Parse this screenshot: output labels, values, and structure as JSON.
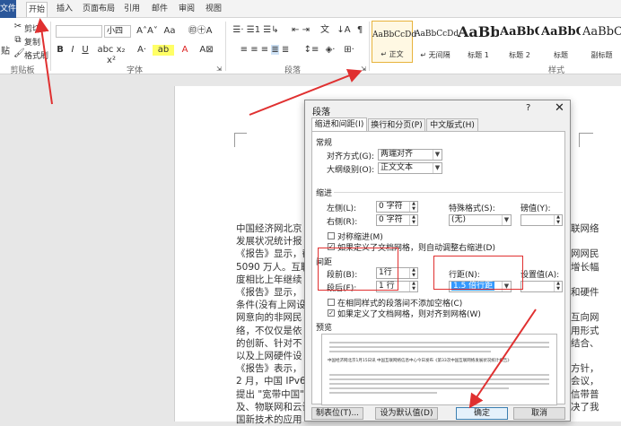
{
  "ribbon": {
    "tabs": [
      "文件",
      "开始",
      "插入",
      "页面布局",
      "引用",
      "邮件",
      "审阅",
      "视图"
    ],
    "clipboard": {
      "cut": "剪切",
      "copy": "复制",
      "paste_stub": "贴",
      "format_painter": "格式刷",
      "label": "剪贴板"
    },
    "font": {
      "size": "小四",
      "label": "字体"
    },
    "paragraph": {
      "label": "段落"
    },
    "styles": {
      "label": "样式",
      "items": [
        {
          "preview": "AaBbCcDd",
          "name": "↵ 正文"
        },
        {
          "preview": "AaBbCcDd",
          "name": "↵ 无间隔"
        },
        {
          "preview": "AaBb",
          "name": "标题 1"
        },
        {
          "preview": "AaBbC",
          "name": "标题 2"
        },
        {
          "preview": "AaBbC",
          "name": "标题"
        },
        {
          "preview": "AaBbC",
          "name": "副标题"
        }
      ]
    }
  },
  "document": {
    "left_lines": [
      "中国经济网北京",
      "发展状况统计报",
      "《报告》显示，截",
      "5090 万人。互联",
      "度相比上年继续",
      "《报告》显示，",
      "条件(没有上网设",
      "网意向的非网民",
      "络，不仅仅是依",
      "的创新、针对不",
      "以及上网硬件设",
      "《报告》表示，",
      "2 月，中国 IPv6 发",
      "提出 \"宽带中国\"",
      "及、物联网和云计",
      "国新技术的应用"
    ],
    "right_lines": [
      "联网络",
      "",
      "网网民",
      "增长幅",
      "",
      "和硬件",
      "",
      "互向网",
      "用形式",
      "结合、",
      "",
      "方针，",
      "会议，",
      "信带普",
      "决了我",
      ""
    ]
  },
  "dialog": {
    "title": "段落",
    "help": "?",
    "close": "✕",
    "tabs": [
      "缩进和间距(I)",
      "换行和分页(P)",
      "中文版式(H)"
    ],
    "general": {
      "label": "常规",
      "alignment_label": "对齐方式(G):",
      "alignment_value": "两端对齐",
      "outline_label": "大纲级别(O):",
      "outline_value": "正文文本"
    },
    "indent": {
      "label": "缩进",
      "left_label": "左侧(L):",
      "left_value": "0 字符",
      "right_label": "右侧(R):",
      "right_value": "0 字符",
      "special_label": "特殊格式(S):",
      "special_value": "(无)",
      "by_label": "磅值(Y):",
      "mirror_label": "对称缩进(M)",
      "auto_adjust_label": "如果定义了文档网格，则自动调整右缩进(D)"
    },
    "spacing": {
      "label": "间距",
      "before_label": "段前(B):",
      "before_value": "1行",
      "after_label": "段后(F):",
      "after_value": "1 行",
      "line_spacing_label": "行距(N):",
      "line_spacing_value": "1.5 倍行距",
      "at_label": "设置值(A):",
      "no_space_label": "在相同样式的段落间不添加空格(C)",
      "snap_grid_label": "如果定义了文档网格，则对齐到网格(W)"
    },
    "preview_label": "预览",
    "preview_sample": "中国经济网北京1月15日讯 中国互联网络信息中心今日发布《第33次中国互联网络发展状况统计报告》",
    "buttons": {
      "tabs": "制表位(T)...",
      "set_default": "设为默认值(D)",
      "ok": "确定",
      "cancel": "取消"
    }
  },
  "colors": {
    "annotation": "#e03030",
    "file_tab": "#2b579a",
    "selection": "#3399ff"
  }
}
